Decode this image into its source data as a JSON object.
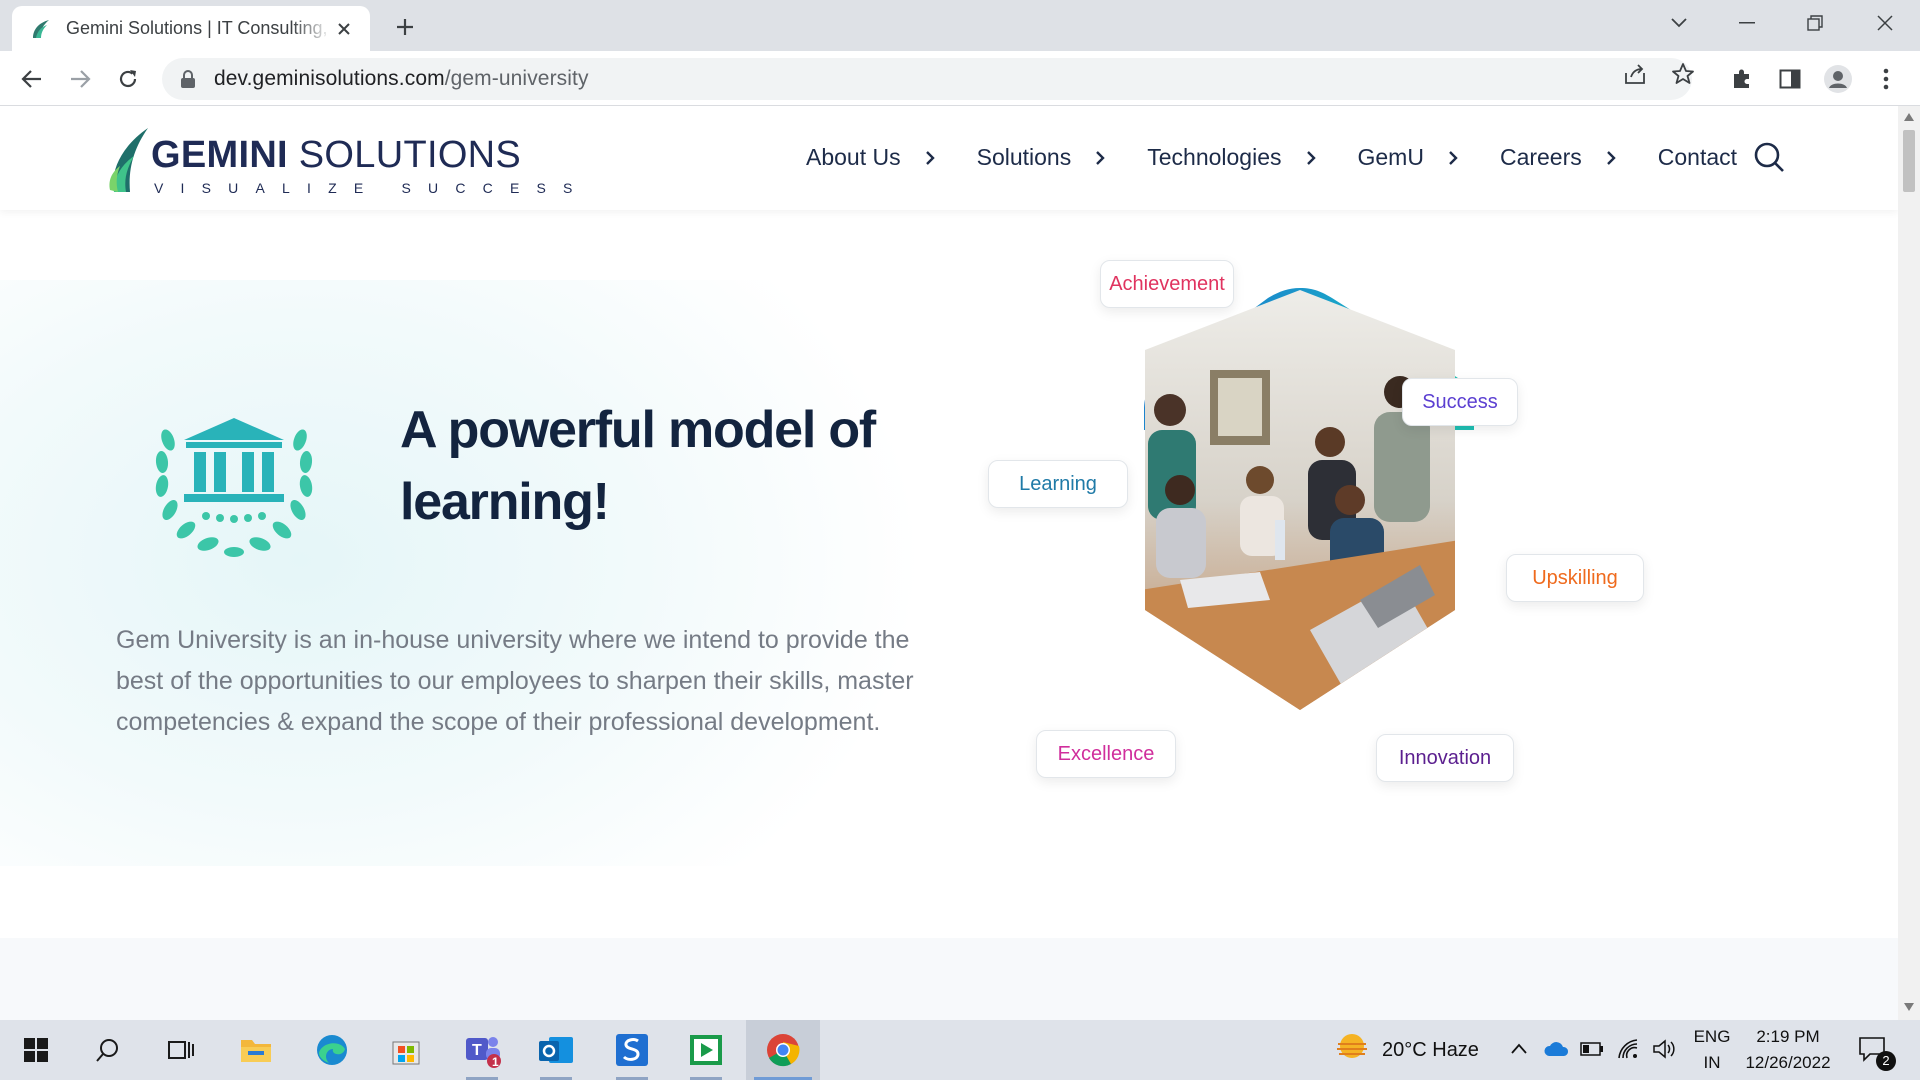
{
  "browser": {
    "tab_title": "Gemini Solutions | IT Consulting, Software Development",
    "url_domain": "dev.geminisolutions.com",
    "url_path": "/gem-university"
  },
  "site": {
    "logo_word1": "GEMINI",
    "logo_word2": " SOLUTIONS",
    "tagline": "VISUALIZE SUCCESS",
    "nav": [
      {
        "label": "About Us"
      },
      {
        "label": "Solutions"
      },
      {
        "label": "Technologies"
      },
      {
        "label": "GemU"
      },
      {
        "label": "Careers"
      },
      {
        "label": "Contact"
      }
    ]
  },
  "hero": {
    "title": "A powerful model of learning!",
    "description": "Gem University is an in-house university where we intend to provide the best of the opportunities to our employees to sharpen their skills, master competencies & expand the scope of their professional development.",
    "chips": {
      "achievement": "Achievement",
      "success": "Success",
      "learning": "Learning",
      "upskilling": "Upskilling",
      "excellence": "Excellence",
      "innovation": "Innovation"
    },
    "chip_colors": {
      "achievement": "#e0335f",
      "success": "#5b3fd1",
      "learning": "#1f7aa7",
      "upskilling": "#ef6a1d",
      "excellence": "#d02e9c",
      "innovation": "#5b1f8f"
    }
  },
  "taskbar": {
    "weather": "20°C  Haze",
    "lang_top": "ENG",
    "lang_bottom": "IN",
    "time": "2:19 PM",
    "date": "12/26/2022",
    "teams_badge": "1",
    "notif_badge": "2"
  },
  "colors": {
    "brand_navy": "#1f2b55",
    "brand_teal": "#2ec3a5",
    "hero_title": "#13243f"
  }
}
